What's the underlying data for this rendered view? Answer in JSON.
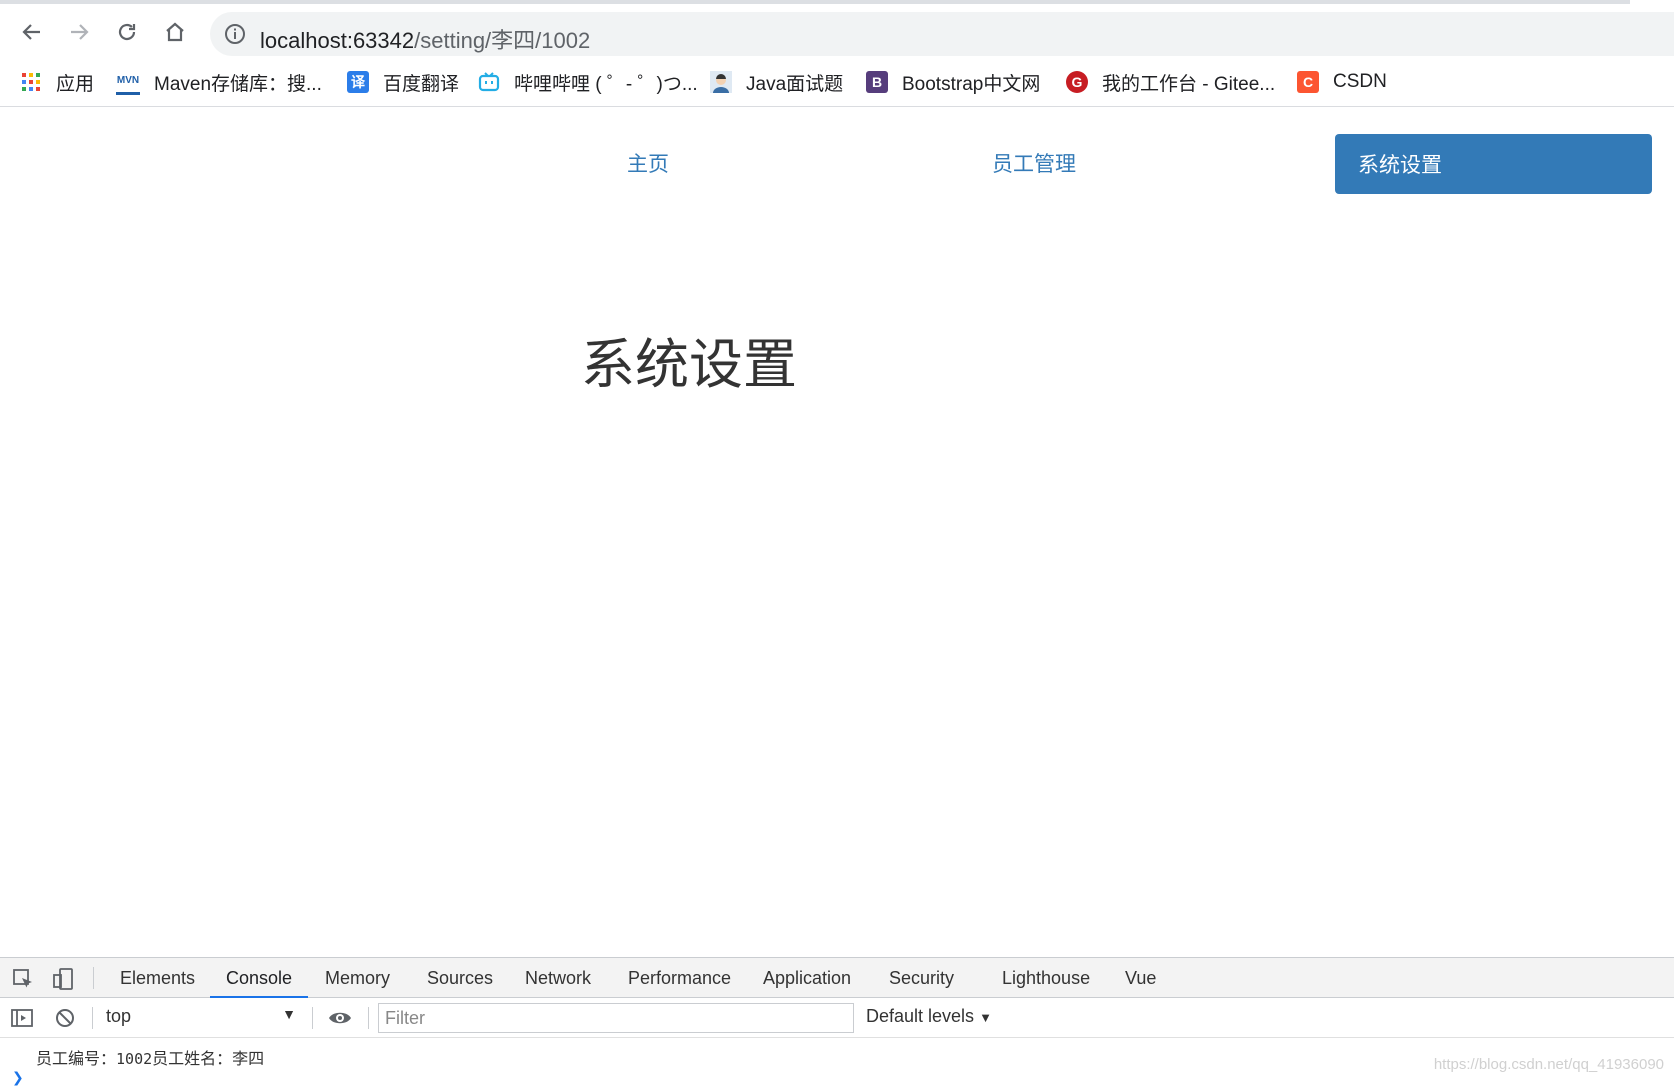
{
  "browser": {
    "url_host": "localhost:63342",
    "url_path": "/setting/李四/1002",
    "bookmarks": [
      {
        "label": "应用",
        "icon": "apps-grid-icon"
      },
      {
        "label": "Maven存储库：搜...",
        "icon": "mvn-icon",
        "color": "#1f5fa8"
      },
      {
        "label": "百度翻译",
        "icon": "translate-icon",
        "color": "#2b7de9",
        "glyph": "译"
      },
      {
        "label": "哔哩哔哩 ( ゜- ゜)つ...",
        "icon": "bilibili-icon",
        "color": "#23ade5"
      },
      {
        "label": "Java面试题",
        "icon": "avatar-icon"
      },
      {
        "label": "Bootstrap中文网",
        "icon": "bootstrap-icon",
        "color": "#563d7c",
        "glyph": "B"
      },
      {
        "label": "我的工作台 - Gitee...",
        "icon": "gitee-icon",
        "color": "#c71d23",
        "glyph": "G"
      },
      {
        "label": "CSDN",
        "icon": "csdn-icon",
        "color": "#fc5531",
        "glyph": "C"
      }
    ]
  },
  "page": {
    "nav": {
      "home": "主页",
      "employees": "员工管理",
      "settings": "系统设置"
    },
    "heading": "系统设置",
    "accent_color": "#337ab7"
  },
  "devtools": {
    "tabs": [
      "Elements",
      "Console",
      "Memory",
      "Sources",
      "Network",
      "Performance",
      "Application",
      "Security",
      "Lighthouse",
      "Vue"
    ],
    "active_tab": "Console",
    "context": "top",
    "filter_placeholder": "Filter",
    "levels": "Default levels",
    "console_prefix": "员工编号：",
    "console_id": "1002",
    "console_suffix": "员工姓名：李四"
  },
  "watermark": "https://blog.csdn.net/qq_41936090"
}
